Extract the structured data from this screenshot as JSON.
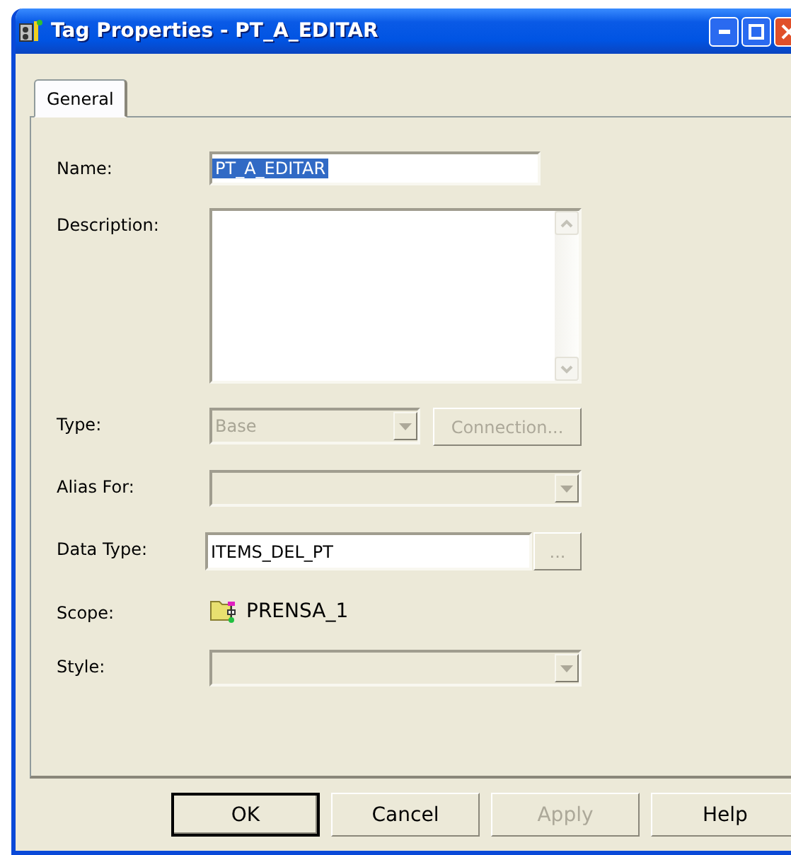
{
  "window": {
    "title": "Tag Properties - PT_A_EDITAR"
  },
  "tabs": [
    {
      "label": "General",
      "selected": true
    }
  ],
  "fields": [
    {
      "kind": "text",
      "label": "Name:",
      "value": "PT_A_EDITAR",
      "highlighted": true
    },
    {
      "kind": "memo",
      "label": "Description:"
    },
    {
      "kind": "combo",
      "label": "Type:",
      "value": "Base",
      "disabled": true,
      "button": {
        "label": "Connection...",
        "disabled": true
      }
    },
    {
      "kind": "combo",
      "label": "Alias For:",
      "disabled": true
    },
    {
      "kind": "browse",
      "label": "Data Type:",
      "value": "ITEMS_DEL_PT",
      "button": {
        "label": "...",
        "disabled": true
      }
    },
    {
      "kind": "scope",
      "label": "Scope:",
      "value": "PRENSA_1"
    },
    {
      "kind": "combo",
      "label": "Style:",
      "disabled": true
    }
  ],
  "buttons": [
    {
      "label": "OK",
      "default": true,
      "disabled": false
    },
    {
      "label": "Cancel",
      "default": false,
      "disabled": false
    },
    {
      "label": "Apply",
      "default": false,
      "disabled": true
    },
    {
      "label": "Help",
      "default": false,
      "disabled": false
    }
  ]
}
